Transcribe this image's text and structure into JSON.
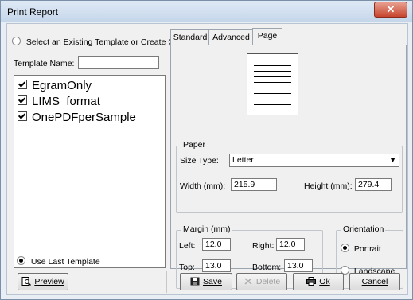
{
  "window": {
    "title": "Print Report",
    "close_symbol": "✕"
  },
  "left": {
    "select_radio_label": "Select an Existing Template or Create One",
    "template_name_label": "Template Name:",
    "template_name_value": "",
    "templates": [
      "EgramOnly",
      "LIMS_format",
      "OnePDFperSample"
    ],
    "use_last_label": "Use Last Template"
  },
  "tabs": [
    {
      "label": "Standard"
    },
    {
      "label": "Advanced"
    },
    {
      "label": "Page",
      "active": true
    }
  ],
  "page": {
    "paper": {
      "title": "Paper",
      "size_type_label": "Size Type:",
      "size_type_value": "Letter",
      "width_label": "Width (mm):",
      "width_value": "215.9",
      "height_label": "Height (mm):",
      "height_value": "279.4"
    },
    "margin": {
      "title": "Margin (mm)",
      "left_label": "Left:",
      "left_value": "12.0",
      "right_label": "Right:",
      "right_value": "12.0",
      "top_label": "Top:",
      "top_value": "13.0",
      "bottom_label": "Bottom:",
      "bottom_value": "13.0"
    },
    "orientation": {
      "title": "Orientation",
      "portrait_label": "Portrait",
      "landscape_label": "Landscape",
      "selected": "Portrait"
    }
  },
  "buttons": {
    "preview": "Preview",
    "save": "Save",
    "delete": "Delete",
    "ok": "Ok",
    "cancel": "Cancel"
  }
}
